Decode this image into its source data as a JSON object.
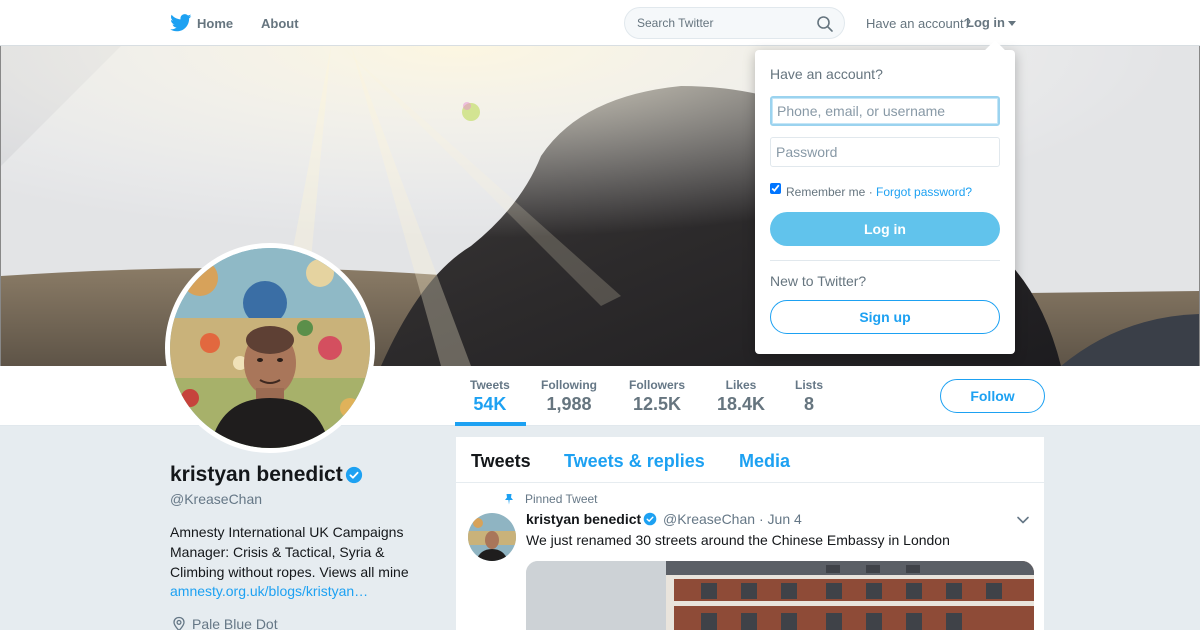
{
  "nav": {
    "logo_icon": "twitter-bird-icon",
    "home_label": "Home",
    "about_label": "About",
    "search_placeholder": "Search Twitter",
    "have_account_label": "Have an account?",
    "login_label": "Log in"
  },
  "login_dropdown": {
    "title": "Have an account?",
    "username_placeholder": "Phone, email, or username",
    "password_placeholder": "Password",
    "remember_label": "Remember me",
    "separator": "·",
    "forgot_label": "Forgot password?",
    "remember_checked": true,
    "login_button": "Log in",
    "new_label": "New to Twitter?",
    "signup_button": "Sign up"
  },
  "stats": [
    {
      "label": "Tweets",
      "value": "54K"
    },
    {
      "label": "Following",
      "value": "1,988"
    },
    {
      "label": "Followers",
      "value": "12.5K"
    },
    {
      "label": "Likes",
      "value": "18.4K"
    },
    {
      "label": "Lists",
      "value": "8"
    }
  ],
  "follow_button": "Follow",
  "profile": {
    "name": "kristyan benedict",
    "handle": "@KreaseChan",
    "bio": "Amnesty International UK Campaigns Manager: Crisis & Tactical, Syria & Climbing without ropes. Views all mine",
    "link": "amnesty.org.uk/blogs/kristyan…",
    "location": "Pale Blue Dot"
  },
  "timeline": {
    "tabs": [
      "Tweets",
      "Tweets & replies",
      "Media"
    ],
    "pinned_label": "Pinned Tweet",
    "tweet": {
      "name": "kristyan benedict",
      "handle": "@KreaseChan",
      "time": "· Jun 4",
      "text": "We just renamed 30 streets around the Chinese Embassy in London"
    }
  },
  "colors": {
    "accent": "#1da1f2",
    "login_button": "#61c3ec",
    "background": "#e6ecf0"
  }
}
